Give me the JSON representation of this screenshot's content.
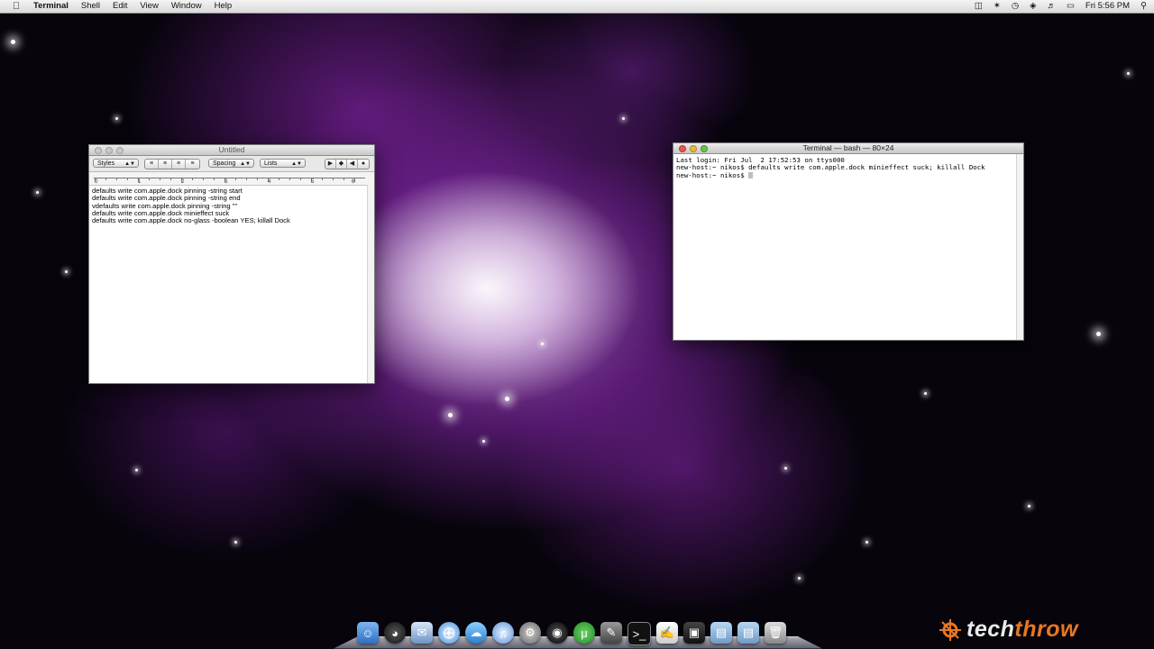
{
  "menubar": {
    "apple": "",
    "items": [
      "Terminal",
      "Shell",
      "Edit",
      "View",
      "Window",
      "Help"
    ],
    "clock": "Fri 5:56 PM"
  },
  "textedit": {
    "title": "Untitled",
    "toolbar": {
      "styles": "Styles",
      "spacing": "Spacing",
      "lists": "Lists"
    },
    "ruler_numbers": [
      "0",
      "1",
      "2",
      "3",
      "4",
      "5",
      "6"
    ],
    "lines": [
      "defaults write com.apple.dock pinning -string start",
      "defaults write com.apple.dock pinning -string end",
      "vdefaults write com.apple.dock pinning -string \"\"",
      "defaults write com.apple.dock minieffect suck",
      "defaults write com.apple.dock no-glass -boolean YES; killall Dock"
    ]
  },
  "terminal": {
    "title": "Terminal — bash — 80×24",
    "lines": [
      "Last login: Fri Jul  2 17:52:53 on ttys000",
      "new-host:~ nikos$ defaults write com.apple.dock minieffect suck; killall Dock",
      "new-host:~ nikos$ "
    ]
  },
  "dock": {
    "icons": [
      "finder-icon",
      "dashboard-icon",
      "mail-icon",
      "safari-icon",
      "ichat-icon",
      "itunes-icon",
      "system-preferences-icon",
      "dvd-player-icon",
      "utorrent-icon",
      "script-editor-icon",
      "terminal-icon",
      "textedit-icon",
      "photo-booth-icon",
      "applications-folder-icon",
      "documents-folder-icon",
      "trash-icon"
    ]
  },
  "watermark": {
    "part1": "tech",
    "part2": "throw"
  }
}
